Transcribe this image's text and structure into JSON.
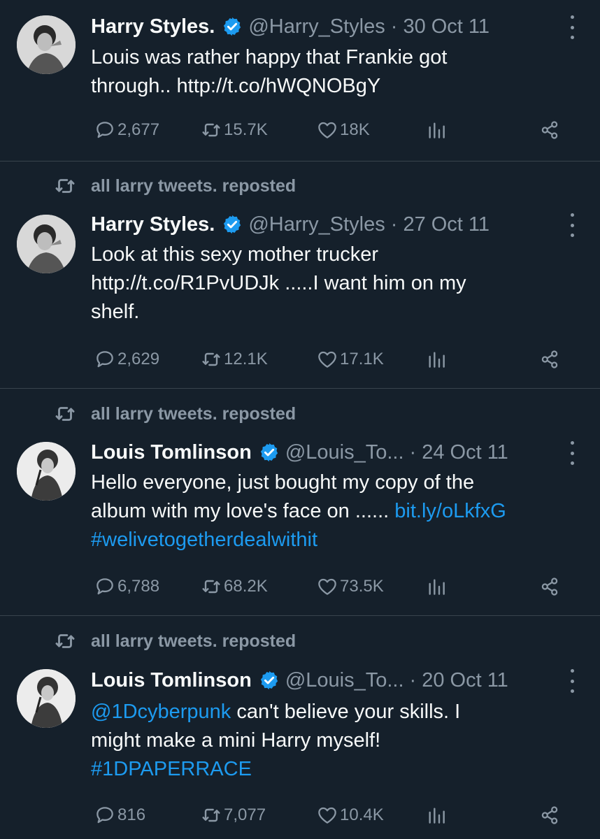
{
  "colors": {
    "background": "#15202b",
    "text": "#f7f9f9",
    "muted": "#8b98a5",
    "link": "#1d9bf0",
    "verified": "#1d9bf0"
  },
  "tweets": [
    {
      "repost_label": "",
      "name": "Harry Styles.",
      "handle": "@Harry_Styles",
      "dot": "·",
      "date": "30 Oct 11",
      "body_lines": [
        "Louis was rather happy that Frankie got",
        "through..  http://t.co/hWQNOBgY"
      ],
      "replies": "2,677",
      "reposts": "15.7K",
      "likes": "18K"
    },
    {
      "repost_label": "all larry tweets. reposted",
      "name": "Harry Styles.",
      "handle": "@Harry_Styles",
      "dot": "·",
      "date": "27 Oct 11",
      "body_lines": [
        "Look at this sexy mother trucker",
        "http://t.co/R1PvUDJk .....I want him on my",
        "shelf."
      ],
      "replies": "2,629",
      "reposts": "12.1K",
      "likes": "17.1K"
    },
    {
      "repost_label": "all larry tweets. reposted",
      "name": "Louis Tomlinson",
      "handle": "@Louis_To...",
      "dot": "·",
      "date": "24 Oct 11",
      "body_line1": "Hello everyone, just bought my copy of the",
      "body_line2_text": "album with my love's face on ...... ",
      "body_line2_link": "bit.ly/oLkfxG",
      "body_line3_link": "#welivetogetherdealwithit",
      "replies": "6,788",
      "reposts": "68.2K",
      "likes": "73.5K"
    },
    {
      "repost_label": "all larry tweets. reposted",
      "name": "Louis Tomlinson",
      "handle": "@Louis_To...",
      "dot": "·",
      "date": "20 Oct 11",
      "body_line1_link": "@1Dcyberpunk",
      "body_line1_text": " can't believe your skills. I",
      "body_line2": "might make a mini Harry myself!",
      "body_line3_link": "#1DPAPERRACE",
      "replies": "816",
      "reposts": "7,077",
      "likes": "10.4K"
    }
  ],
  "icons": {
    "reply": "speech-bubble-icon",
    "repost": "repost-arrows-icon",
    "like": "heart-icon",
    "views": "bar-chart-icon",
    "share": "share-nodes-icon",
    "more": "vertical-ellipsis-icon",
    "verified": "verified-badge-icon"
  }
}
